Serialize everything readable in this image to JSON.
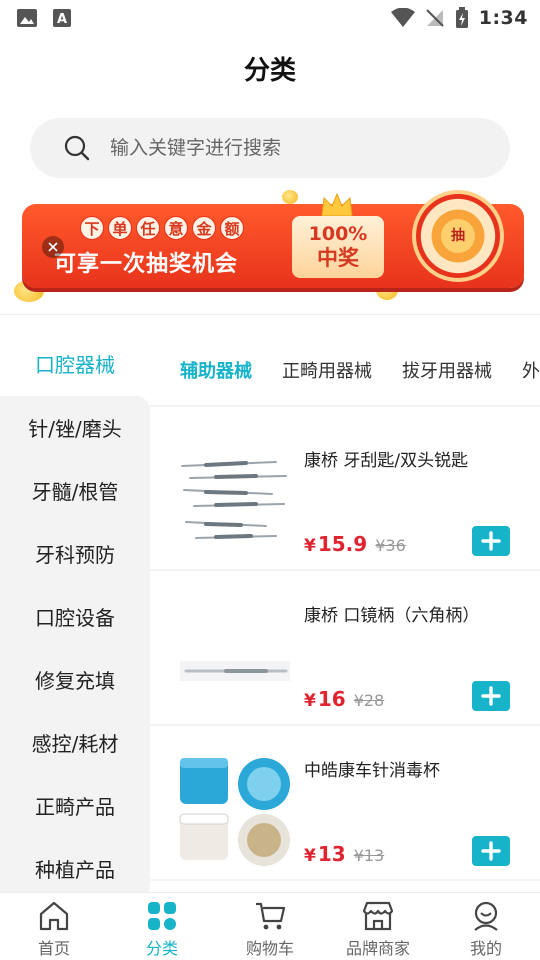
{
  "status_bar": {
    "time": "1:34"
  },
  "header": {
    "title": "分类"
  },
  "search": {
    "placeholder": "输入关键字进行搜索"
  },
  "banner": {
    "chips": [
      "下",
      "单",
      "任",
      "意",
      "金",
      "额"
    ],
    "main_text": "可享一次抽奖机会",
    "prize_line1": "100%",
    "prize_line2": "中奖",
    "wheel_label": "抽"
  },
  "sidebar": {
    "items": [
      {
        "label": "口腔器械",
        "active": true
      },
      {
        "label": "针/锉/磨头"
      },
      {
        "label": "牙髓/根管"
      },
      {
        "label": "牙科预防"
      },
      {
        "label": "口腔设备"
      },
      {
        "label": "修复充填"
      },
      {
        "label": "感控/耗材"
      },
      {
        "label": "正畸产品"
      },
      {
        "label": "种植产品"
      }
    ]
  },
  "subtabs": [
    "辅助器械",
    "正畸用器械",
    "拔牙用器械",
    "外"
  ],
  "products": [
    {
      "name": "康桥 牙刮匙/双头锐匙",
      "currency": "¥",
      "price": "15.9",
      "old_price": "¥36"
    },
    {
      "name": "康桥 口镜柄（六角柄）",
      "currency": "¥",
      "price": "16",
      "old_price": "¥28"
    },
    {
      "name": "中皓康车针消毒杯",
      "currency": "¥",
      "price": "13",
      "old_price": "¥13"
    }
  ],
  "bottom_nav": [
    {
      "label": "首页",
      "icon": "home-icon"
    },
    {
      "label": "分类",
      "icon": "category-icon",
      "active": true
    },
    {
      "label": "购物车",
      "icon": "cart-icon"
    },
    {
      "label": "品牌商家",
      "icon": "store-icon"
    },
    {
      "label": "我的",
      "icon": "user-icon"
    }
  ],
  "colors": {
    "accent": "#16b3c9",
    "price": "#e0242f",
    "banner": "#e8331c"
  }
}
